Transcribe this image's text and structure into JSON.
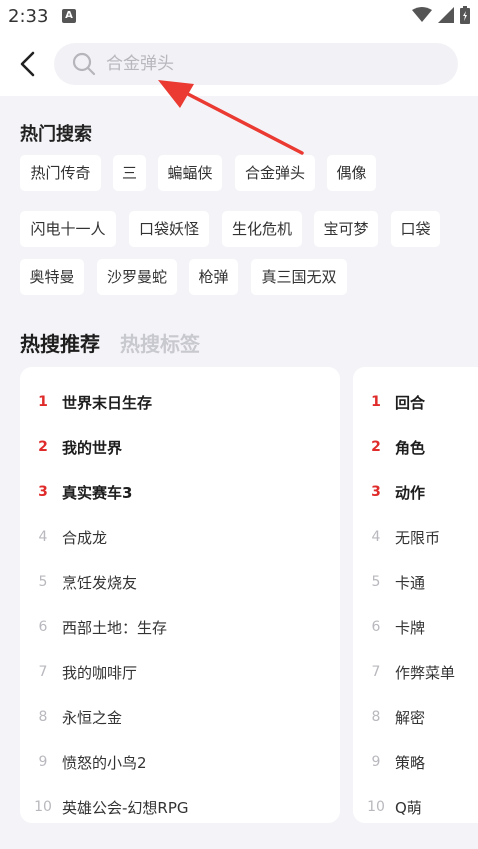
{
  "status": {
    "time": "2:33",
    "app_icon_letter": "A"
  },
  "search": {
    "placeholder": "合金弹头"
  },
  "hot_search": {
    "title": "热门搜索",
    "chips": [
      "热门传奇",
      "三",
      "蝙蝠侠",
      "合金弹头",
      "偶像",
      "闪电十一人",
      "口袋妖怪",
      "生化危机",
      "宝可梦",
      "口袋",
      "奥特曼",
      "沙罗曼蛇",
      "枪弹",
      "真三国无双"
    ]
  },
  "tabs": [
    "热搜推荐",
    "热搜标签"
  ],
  "recommend_list": [
    {
      "rank": "1",
      "label": "世界末日生存"
    },
    {
      "rank": "2",
      "label": "我的世界"
    },
    {
      "rank": "3",
      "label": "真实赛车3"
    },
    {
      "rank": "4",
      "label": "合成龙"
    },
    {
      "rank": "5",
      "label": "烹饪发烧友"
    },
    {
      "rank": "6",
      "label": "西部土地：生存"
    },
    {
      "rank": "7",
      "label": "我的咖啡厅"
    },
    {
      "rank": "8",
      "label": "永恒之金"
    },
    {
      "rank": "9",
      "label": "愤怒的小鸟2"
    },
    {
      "rank": "10",
      "label": "英雄公会-幻想RPG"
    }
  ],
  "tag_list": [
    {
      "rank": "1",
      "label": "回合"
    },
    {
      "rank": "2",
      "label": "角色"
    },
    {
      "rank": "3",
      "label": "动作"
    },
    {
      "rank": "4",
      "label": "无限币"
    },
    {
      "rank": "5",
      "label": "卡通"
    },
    {
      "rank": "6",
      "label": "卡牌"
    },
    {
      "rank": "7",
      "label": "作弊菜单"
    },
    {
      "rank": "8",
      "label": "解密"
    },
    {
      "rank": "9",
      "label": "策略"
    },
    {
      "rank": "10",
      "label": "Q萌"
    }
  ],
  "colors": {
    "accent_red": "#e02b2b",
    "background": "#f4f4f8"
  }
}
